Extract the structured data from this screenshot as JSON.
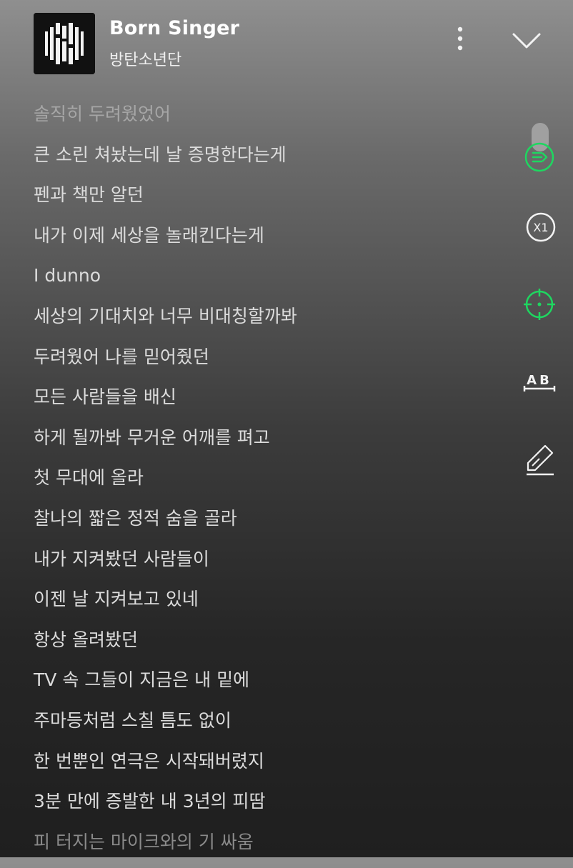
{
  "header": {
    "song_title": "Born Singer",
    "artist": "방탄소년단",
    "icons": {
      "album_art": "album-art",
      "more": "more-vertical-icon",
      "collapse": "chevron-down-icon"
    }
  },
  "lyrics": {
    "lines": [
      "솔직히 두려웠었어",
      "큰 소린 쳐놨는데 날 증명한다는게",
      "펜과 책만 알던",
      "내가 이제 세상을 놀래킨다는게",
      "I dunno",
      "세상의 기대치와 너무 비대칭할까봐",
      "두려웠어 나를 믿어줬던",
      "모든 사람들을 배신",
      "하게 될까봐 무거운 어깨를 펴고",
      "첫 무대에 올라",
      "찰나의 짧은 정적 숨을 골라",
      "내가 지켜봤던 사람들이",
      "이젠 날 지켜보고 있네",
      "항상 올려봤던",
      "TV 속 그들이 지금은 내 밑에",
      "주마등처럼 스칠 틈도 없이",
      "한 번뿐인 연극은 시작돼버렸지",
      "3분 만에 증발한 내 3년의 피땀",
      "피 터지는 마이크와의 기 싸움"
    ]
  },
  "side_tools": {
    "speed_label": "X1",
    "ab_label": "AB",
    "icons": [
      "lyrics-sync-icon",
      "speed-icon",
      "crosshair-icon",
      "ab-repeat-icon",
      "edit-icon"
    ],
    "accent_color": "#1ed760"
  }
}
